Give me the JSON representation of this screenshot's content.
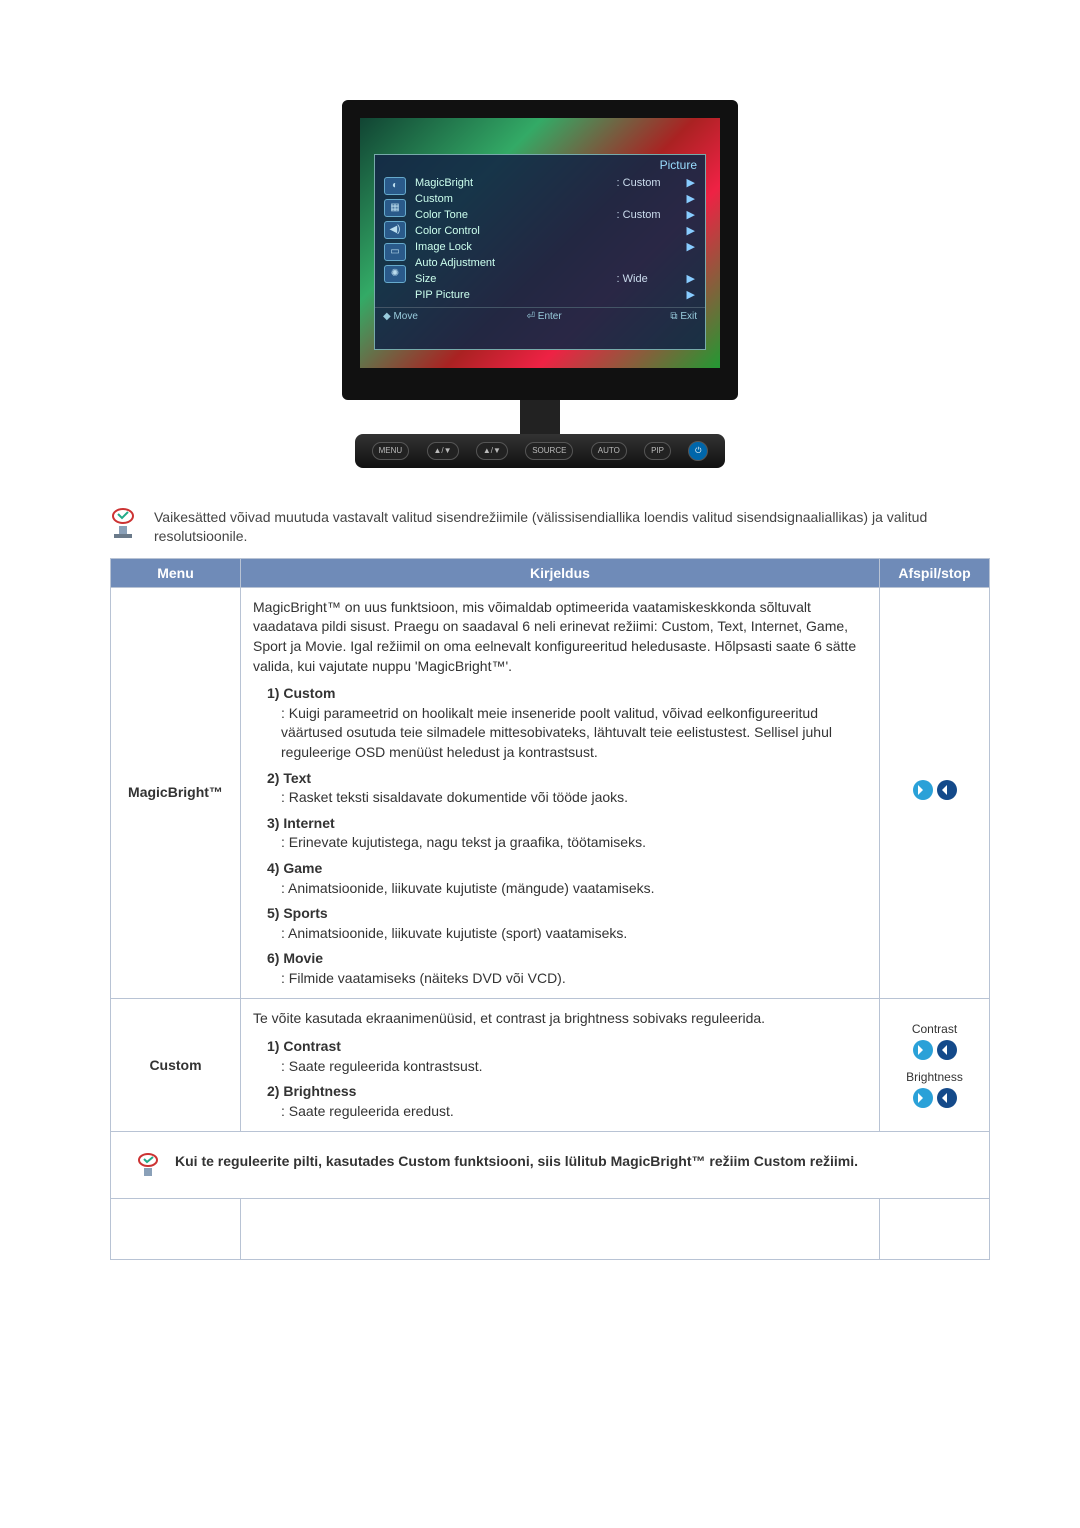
{
  "monitor": {
    "osd_title": "Picture",
    "items": [
      {
        "label": "MagicBright",
        "value": ": Custom",
        "arrow": true
      },
      {
        "label": "Custom",
        "value": "",
        "arrow": true
      },
      {
        "label": "Color Tone",
        "value": ": Custom",
        "arrow": true
      },
      {
        "label": "Color Control",
        "value": "",
        "arrow": true
      },
      {
        "label": "Image Lock",
        "value": "",
        "arrow": true
      },
      {
        "label": "Auto Adjustment",
        "value": "",
        "arrow": false
      },
      {
        "label": "Size",
        "value": ": Wide",
        "arrow": true
      },
      {
        "label": "PIP Picture",
        "value": "",
        "arrow": true
      }
    ],
    "footer": {
      "move": "Move",
      "enter": "Enter",
      "exit": "Exit"
    },
    "buttons": [
      "MENU",
      "▲/▼",
      "▲/▼",
      "SOURCE",
      "AUTO",
      "PIP"
    ]
  },
  "top_note": "Vaikesätted võivad muutuda vastavalt valitud sisendrežiimile (välissisendiallika loendis valitud sisendsignaaliallikas) ja valitud resolutsioonile.",
  "table": {
    "headers": {
      "menu": "Menu",
      "desc": "Kirjeldus",
      "af": "Afspil/stop"
    },
    "rows": [
      {
        "menu": "MagicBright™",
        "intro": "MagicBright™ on uus funktsioon, mis võimaldab optimeerida vaatamiskeskkonda sõltuvalt vaadatava pildi sisust. Praegu on saadaval 6 neli erinevat režiimi: Custom, Text, Internet, Game, Sport ja Movie. Igal režiimil on oma eelnevalt konfigureeritud heledusaste. Hõlpsasti saate 6 sätte valida, kui vajutate nuppu 'MagicBright™'.",
        "modes": [
          {
            "num": "1) Custom",
            "desc": ": Kuigi parameetrid on hoolikalt meie inseneride poolt valitud, võivad eelkonfigureeritud väärtused osutuda teie silmadele mittesobivateks, lähtuvalt teie eelistustest. Sellisel juhul reguleerige OSD menüüst heledust ja kontrastsust."
          },
          {
            "num": "2) Text",
            "desc": ": Rasket teksti sisaldavate dokumentide või tööde jaoks."
          },
          {
            "num": "3) Internet",
            "desc": ": Erinevate kujutistega, nagu tekst ja graafika, töötamiseks."
          },
          {
            "num": "4) Game",
            "desc": ": Animatsioonide, liikuvate kujutiste (mängude) vaatamiseks."
          },
          {
            "num": "5) Sports",
            "desc": ": Animatsioonide, liikuvate kujutiste (sport) vaatamiseks."
          },
          {
            "num": "6) Movie",
            "desc": ": Filmide vaatamiseks (näiteks DVD või VCD)."
          }
        ],
        "af": {
          "kind": "single"
        }
      },
      {
        "menu": "Custom",
        "intro": "Te võite kasutada ekraanimenüüsid, et contrast ja brightness sobivaks reguleerida.",
        "modes": [
          {
            "num": "1) Contrast",
            "desc": ": Saate reguleerida kontrastsust."
          },
          {
            "num": "2) Brightness",
            "desc": ": Saate reguleerida eredust."
          }
        ],
        "af": {
          "kind": "double",
          "labels": [
            "Contrast",
            "Brightness"
          ]
        }
      }
    ],
    "note_row": "Kui te reguleerite pilti, kasutades Custom funktsiooni, siis lülitub MagicBright™ režiim Custom režiimi."
  }
}
